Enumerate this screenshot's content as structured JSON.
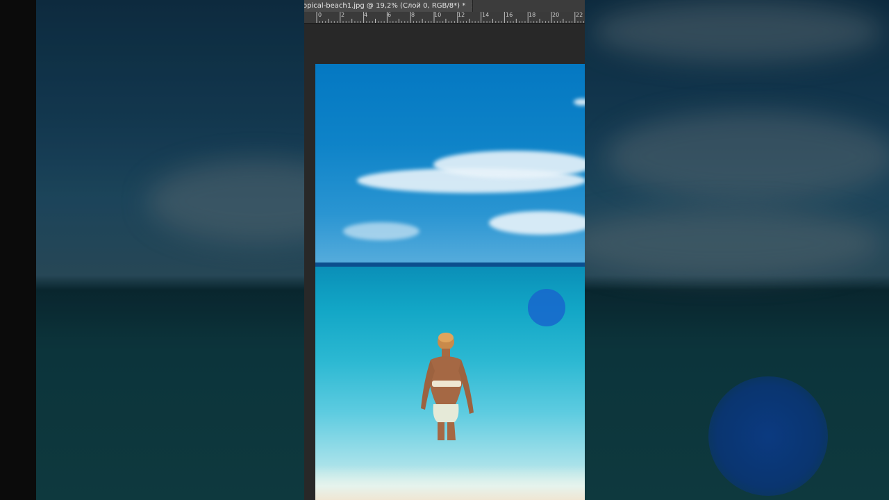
{
  "document_tab": {
    "title": "opical-beach1.jpg @ 19,2% (Слой 0, RGB/8*) *",
    "close_glyph": "×"
  },
  "ruler": {
    "labels": [
      "0",
      "2",
      "4",
      "6",
      "8",
      "10",
      "12",
      "14",
      "16",
      "18",
      "20",
      "22"
    ]
  },
  "colors": {
    "workspace": "#282828",
    "tabbar": "#3c3c3c",
    "ruler": "#3a3a3a",
    "brush": "#1866cc"
  },
  "icons": {
    "tab_close": "close-icon"
  }
}
